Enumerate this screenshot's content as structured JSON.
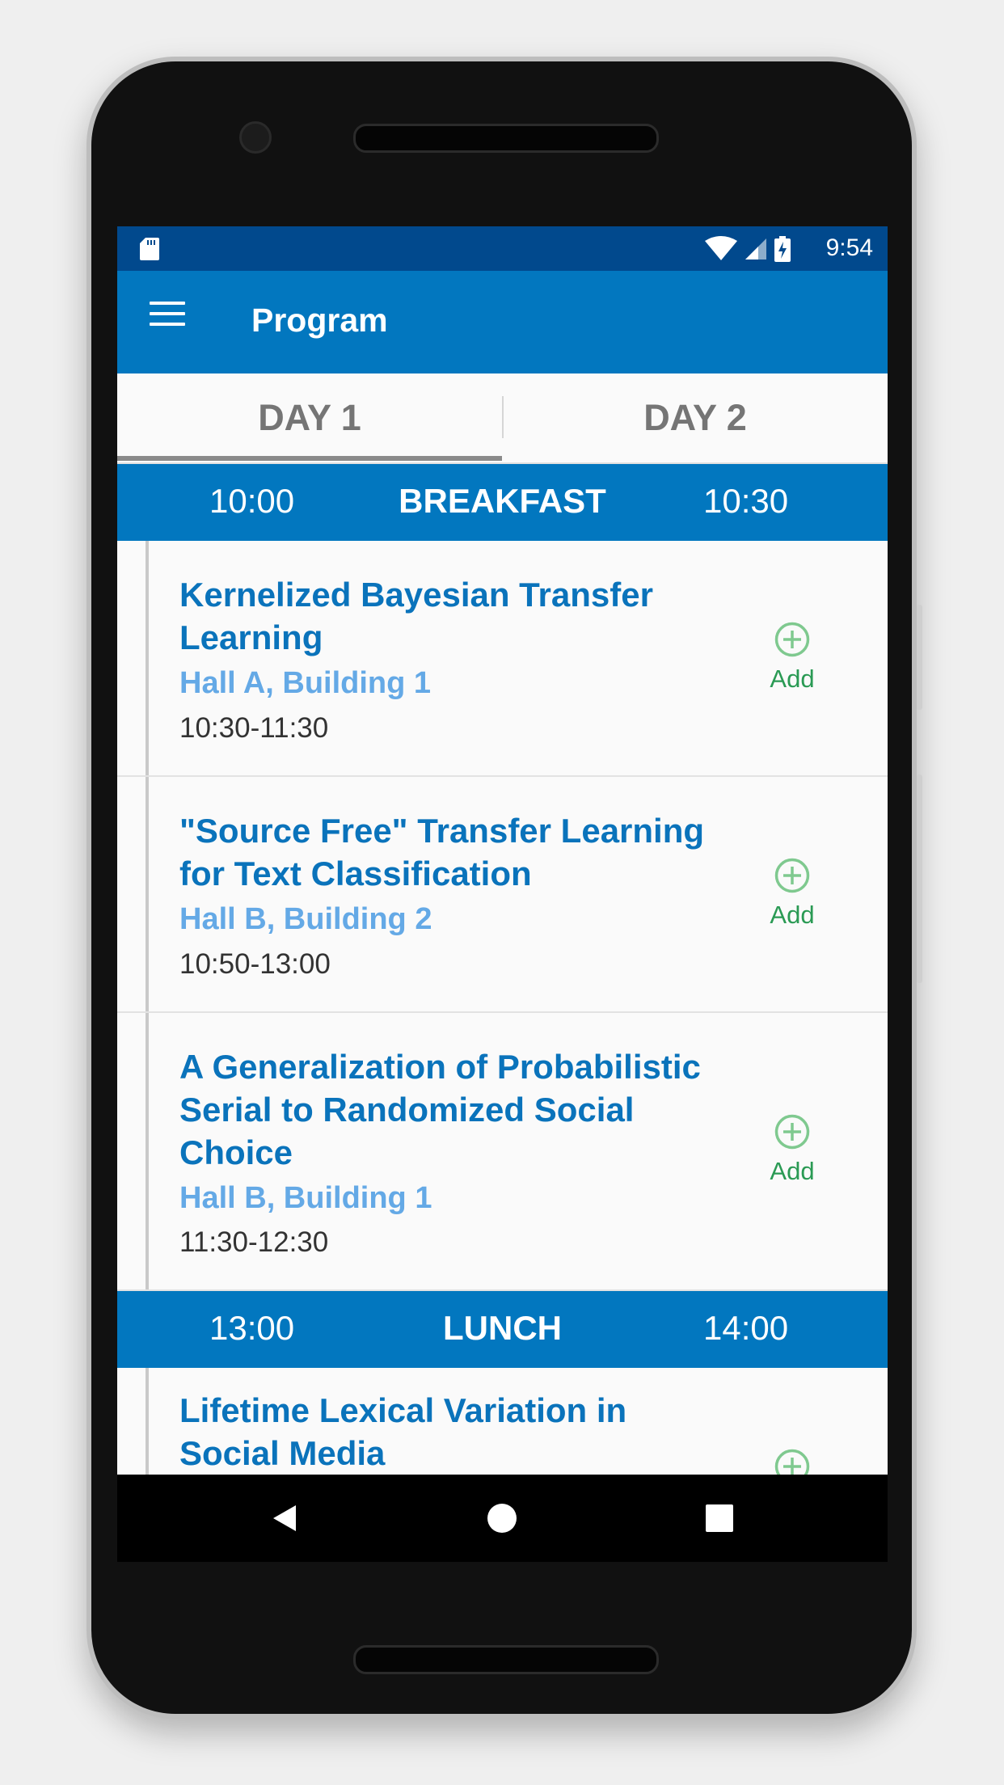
{
  "statusbar": {
    "time": "9:54"
  },
  "appbar": {
    "title": "Program"
  },
  "tabs": [
    {
      "label": "DAY 1",
      "selected": true
    },
    {
      "label": "DAY 2",
      "selected": false
    }
  ],
  "colors": {
    "primary": "#0277bf",
    "status_bar": "#01498d",
    "title_blue": "#0a73bb",
    "venue_blue": "#64a9e6",
    "add_green": "#2a9a54"
  },
  "bands": [
    {
      "start": "10:00",
      "label": "BREAKFAST",
      "end": "10:30"
    },
    {
      "start": "13:00",
      "label": "LUNCH",
      "end": "14:00"
    }
  ],
  "sessions": [
    {
      "title": "Kernelized Bayesian Transfer Learning",
      "venue": "Hall A, Building 1",
      "time": "10:30-11:30",
      "action": "Add"
    },
    {
      "title": "\"Source Free\" Transfer Learning for Text Classification",
      "venue": "Hall B, Building 2",
      "time": "10:50-13:00",
      "action": "Add"
    },
    {
      "title": "A Generalization of Probabilistic Serial to Randomized Social Choice",
      "venue": "Hall B, Building 1",
      "time": "11:30-12:30",
      "action": "Add"
    },
    {
      "title": "Lifetime Lexical Variation in Social Media",
      "venue": "",
      "time": "",
      "action": ""
    }
  ],
  "icons": {
    "status": [
      "sd-card-icon",
      "wifi-icon",
      "cell-signal-icon",
      "battery-charging-icon"
    ],
    "nav": [
      "back-icon",
      "home-icon",
      "recents-icon"
    ],
    "menu": "menu-icon",
    "add": "add-circle-icon"
  }
}
